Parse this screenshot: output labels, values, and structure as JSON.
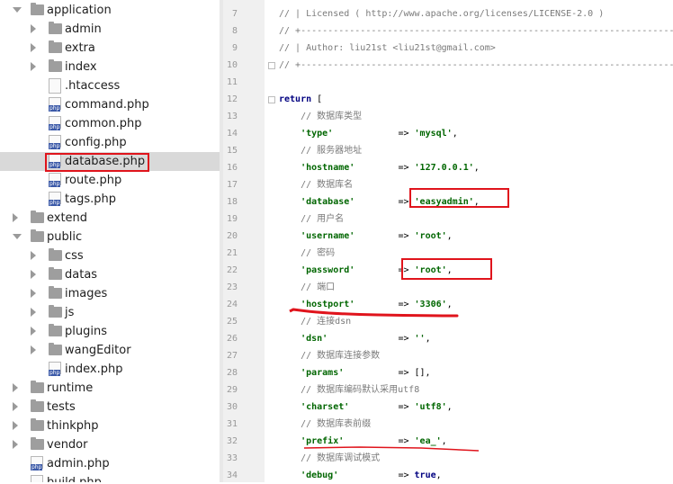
{
  "tree": [
    {
      "label": "application",
      "kind": "folder",
      "state": "open",
      "depth": 0
    },
    {
      "label": "admin",
      "kind": "folder",
      "state": "closed",
      "depth": 1
    },
    {
      "label": "extra",
      "kind": "folder",
      "state": "closed",
      "depth": 1
    },
    {
      "label": "index",
      "kind": "folder",
      "state": "closed",
      "depth": 1
    },
    {
      "label": ".htaccess",
      "kind": "file",
      "depth": 1
    },
    {
      "label": "command.php",
      "kind": "php",
      "depth": 1
    },
    {
      "label": "common.php",
      "kind": "php",
      "depth": 1
    },
    {
      "label": "config.php",
      "kind": "php",
      "depth": 1
    },
    {
      "label": "database.php",
      "kind": "php",
      "depth": 1,
      "selected": true
    },
    {
      "label": "route.php",
      "kind": "php",
      "depth": 1
    },
    {
      "label": "tags.php",
      "kind": "php",
      "depth": 1
    },
    {
      "label": "extend",
      "kind": "folder",
      "state": "closed",
      "depth": 0
    },
    {
      "label": "public",
      "kind": "folder",
      "state": "open",
      "depth": 0
    },
    {
      "label": "css",
      "kind": "folder",
      "state": "closed",
      "depth": 1
    },
    {
      "label": "datas",
      "kind": "folder",
      "state": "closed",
      "depth": 1
    },
    {
      "label": "images",
      "kind": "folder",
      "state": "closed",
      "depth": 1
    },
    {
      "label": "js",
      "kind": "folder",
      "state": "closed",
      "depth": 1
    },
    {
      "label": "plugins",
      "kind": "folder",
      "state": "closed",
      "depth": 1
    },
    {
      "label": "wangEditor",
      "kind": "folder",
      "state": "closed",
      "depth": 1
    },
    {
      "label": "index.php",
      "kind": "php",
      "depth": 1
    },
    {
      "label": "runtime",
      "kind": "folder",
      "state": "closed",
      "depth": 0
    },
    {
      "label": "tests",
      "kind": "folder",
      "state": "closed",
      "depth": 0
    },
    {
      "label": "thinkphp",
      "kind": "folder",
      "state": "closed",
      "depth": 0
    },
    {
      "label": "vendor",
      "kind": "folder",
      "state": "closed",
      "depth": 0
    },
    {
      "label": "admin.php",
      "kind": "php",
      "depth": 0
    },
    {
      "label": "build.php",
      "kind": "php",
      "depth": 0
    }
  ],
  "php_badge": "php",
  "code": [
    {
      "num": "7",
      "parts": [
        {
          "t": "// | Licensed ( http://www.apache.org/licenses/LICENSE-2.0 )",
          "c": "cm"
        }
      ]
    },
    {
      "num": "8",
      "parts": [
        {
          "t": "// +----------------------------------------------------------------------",
          "c": "cm"
        }
      ]
    },
    {
      "num": "9",
      "parts": [
        {
          "t": "// | Author: liu21st <liu21st@gmail.com>",
          "c": "cm"
        }
      ]
    },
    {
      "num": "10",
      "parts": [
        {
          "t": "// +----------------------------------------------------------------------",
          "c": "cm"
        }
      ]
    },
    {
      "num": "11",
      "parts": []
    },
    {
      "num": "12",
      "parts": [
        {
          "t": "return",
          "c": "kw"
        },
        {
          "t": " [",
          "c": "op"
        }
      ]
    },
    {
      "num": "13",
      "parts": [
        {
          "t": "    // 数据库类型",
          "c": "cm"
        }
      ]
    },
    {
      "num": "14",
      "parts": [
        {
          "t": "    'type'",
          "c": "key"
        },
        {
          "t": "            => ",
          "c": "op"
        },
        {
          "t": "'mysql'",
          "c": "str"
        },
        {
          "t": ",",
          "c": "op"
        }
      ]
    },
    {
      "num": "15",
      "parts": [
        {
          "t": "    // 服务器地址",
          "c": "cm"
        }
      ]
    },
    {
      "num": "16",
      "parts": [
        {
          "t": "    'hostname'",
          "c": "key"
        },
        {
          "t": "        => ",
          "c": "op"
        },
        {
          "t": "'127.0.0.1'",
          "c": "str"
        },
        {
          "t": ",",
          "c": "op"
        }
      ]
    },
    {
      "num": "17",
      "parts": [
        {
          "t": "    // 数据库名",
          "c": "cm"
        }
      ]
    },
    {
      "num": "18",
      "parts": [
        {
          "t": "    'database'",
          "c": "key"
        },
        {
          "t": "        => ",
          "c": "op"
        },
        {
          "t": "'easyadmin'",
          "c": "str"
        },
        {
          "t": ",",
          "c": "op"
        }
      ]
    },
    {
      "num": "19",
      "parts": [
        {
          "t": "    // 用户名",
          "c": "cm"
        }
      ]
    },
    {
      "num": "20",
      "parts": [
        {
          "t": "    'username'",
          "c": "key"
        },
        {
          "t": "        => ",
          "c": "op"
        },
        {
          "t": "'root'",
          "c": "str"
        },
        {
          "t": ",",
          "c": "op"
        }
      ]
    },
    {
      "num": "21",
      "parts": [
        {
          "t": "    // 密码",
          "c": "cm"
        }
      ]
    },
    {
      "num": "22",
      "parts": [
        {
          "t": "    'password'",
          "c": "key"
        },
        {
          "t": "        => ",
          "c": "op"
        },
        {
          "t": "'root'",
          "c": "str"
        },
        {
          "t": ",",
          "c": "op"
        }
      ]
    },
    {
      "num": "23",
      "parts": [
        {
          "t": "    // 端口",
          "c": "cm"
        }
      ]
    },
    {
      "num": "24",
      "parts": [
        {
          "t": "    'hostport'",
          "c": "key"
        },
        {
          "t": "        => ",
          "c": "op"
        },
        {
          "t": "'3306'",
          "c": "str"
        },
        {
          "t": ",",
          "c": "op"
        }
      ]
    },
    {
      "num": "25",
      "parts": [
        {
          "t": "    // 连接dsn",
          "c": "cm"
        }
      ]
    },
    {
      "num": "26",
      "parts": [
        {
          "t": "    'dsn'",
          "c": "key"
        },
        {
          "t": "             => ",
          "c": "op"
        },
        {
          "t": "''",
          "c": "str"
        },
        {
          "t": ",",
          "c": "op"
        }
      ]
    },
    {
      "num": "27",
      "parts": [
        {
          "t": "    // 数据库连接参数",
          "c": "cm"
        }
      ]
    },
    {
      "num": "28",
      "parts": [
        {
          "t": "    'params'",
          "c": "key"
        },
        {
          "t": "          => [],",
          "c": "op"
        }
      ]
    },
    {
      "num": "29",
      "parts": [
        {
          "t": "    // 数据库编码默认采用utf8",
          "c": "cm"
        }
      ]
    },
    {
      "num": "30",
      "parts": [
        {
          "t": "    'charset'",
          "c": "key"
        },
        {
          "t": "         => ",
          "c": "op"
        },
        {
          "t": "'utf8'",
          "c": "str"
        },
        {
          "t": ",",
          "c": "op"
        }
      ]
    },
    {
      "num": "31",
      "parts": [
        {
          "t": "    // 数据库表前缀",
          "c": "cm"
        }
      ]
    },
    {
      "num": "32",
      "parts": [
        {
          "t": "    'prefix'",
          "c": "key"
        },
        {
          "t": "          => ",
          "c": "op"
        },
        {
          "t": "'ea_'",
          "c": "str"
        },
        {
          "t": ",",
          "c": "op"
        }
      ]
    },
    {
      "num": "33",
      "parts": [
        {
          "t": "    // 数据库调试模式",
          "c": "cm"
        }
      ]
    },
    {
      "num": "34",
      "parts": [
        {
          "t": "    'debug'",
          "c": "key"
        },
        {
          "t": "           => ",
          "c": "op"
        },
        {
          "t": "true",
          "c": "kw"
        },
        {
          "t": ",",
          "c": "op"
        }
      ]
    }
  ],
  "colors": {
    "annotation_red": "#e0141c",
    "comment": "#7a7a7a",
    "string": "#006600",
    "keyword": "#000080"
  }
}
